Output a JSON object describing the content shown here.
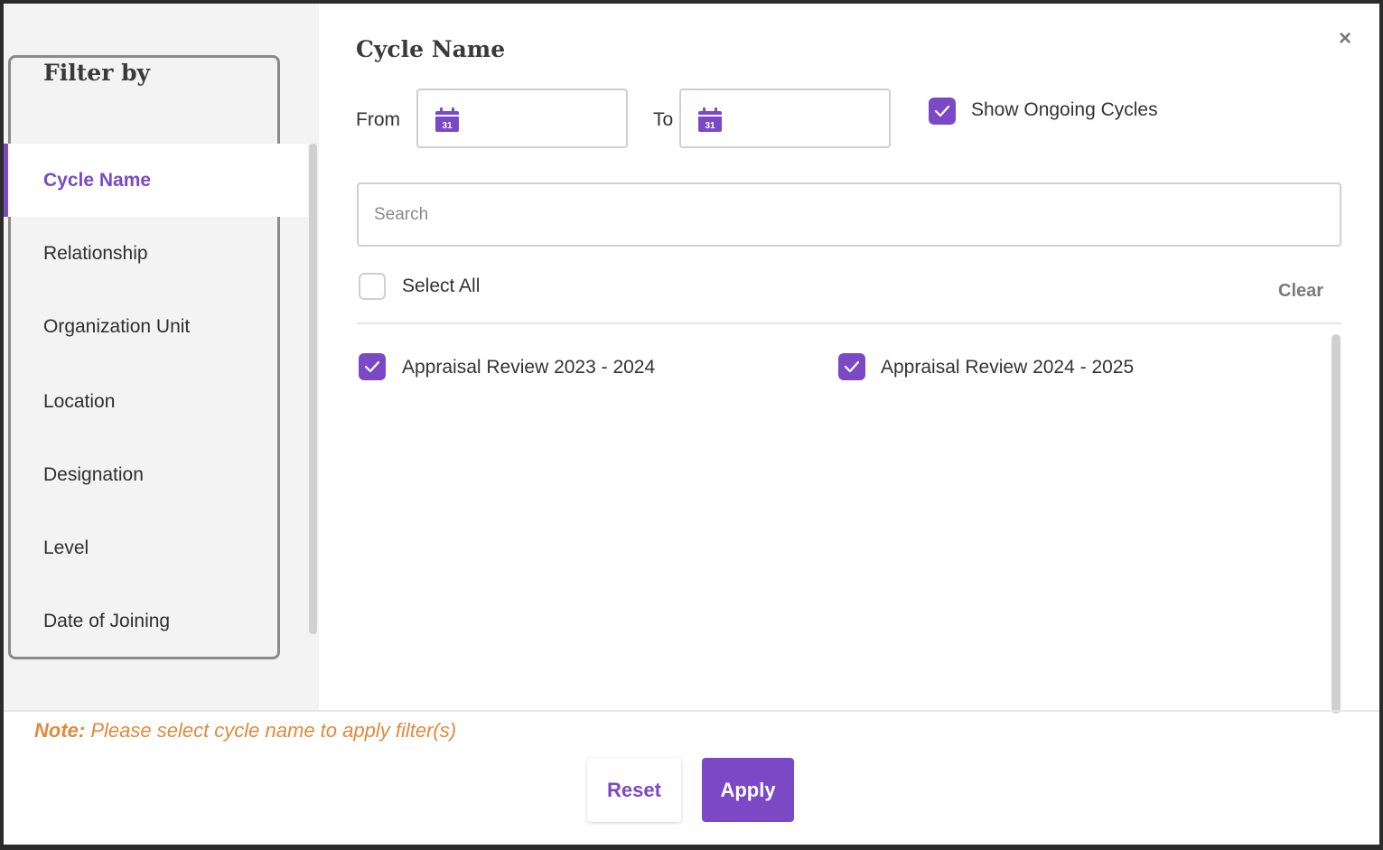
{
  "sidebar": {
    "title": "Filter by",
    "items": [
      {
        "label": "Cycle Name",
        "active": true
      },
      {
        "label": "Relationship",
        "active": false
      },
      {
        "label": "Organization Unit",
        "active": false
      },
      {
        "label": "Location",
        "active": false
      },
      {
        "label": "Designation",
        "active": false
      },
      {
        "label": "Level",
        "active": false
      },
      {
        "label": "Date of Joining",
        "active": false
      }
    ]
  },
  "main": {
    "title": "Cycle Name",
    "close_icon": "close-icon",
    "from_label": "From",
    "to_label": "To",
    "from_value": "",
    "to_value": "",
    "calendar_icon_day": "31",
    "show_ongoing_label": "Show Ongoing Cycles",
    "show_ongoing_checked": true,
    "search_placeholder": "Search",
    "select_all_label": "Select All",
    "select_all_checked": false,
    "clear_label": "Clear",
    "cycles": [
      {
        "label": "Appraisal Review 2023 - 2024",
        "checked": true
      },
      {
        "label": "Appraisal Review 2024 - 2025",
        "checked": true
      }
    ]
  },
  "footer": {
    "note_prefix": "Note:",
    "note_text": " Please select cycle name to apply filter(s)",
    "reset_label": "Reset",
    "apply_label": "Apply"
  },
  "colors": {
    "accent": "#7b49c5",
    "note": "#e08a3c"
  }
}
